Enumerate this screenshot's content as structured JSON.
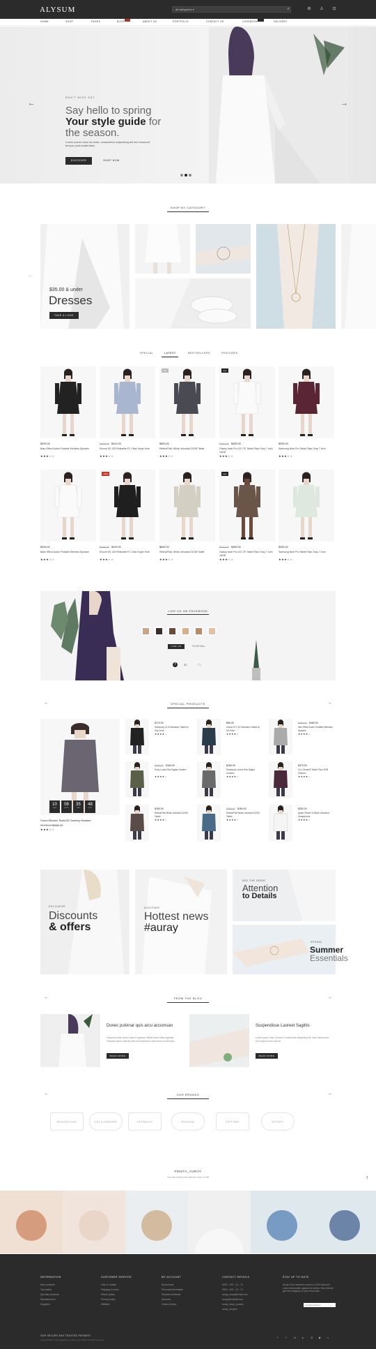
{
  "header": {
    "logo": "ALYSUM",
    "search_placeholder": "all categories",
    "icons": [
      "search-icon",
      "settings-icon",
      "user-icon",
      "cart-icon"
    ]
  },
  "nav": {
    "items": [
      "HOME",
      "SHOP",
      "PAGES",
      "BLOG",
      "ABOUT US",
      "PORTFOLIO",
      "CONTACT US",
      "LOOKBOOK",
      "DELIVERY"
    ],
    "blog_badge": "hot",
    "lookbook_badge": "new"
  },
  "hero": {
    "kicker": "DON'T MISS OUT",
    "line1": "Say hello to spring",
    "line2": "Your style guide",
    "line2_suffix": "for",
    "line3": "the season.",
    "text": "Lorem ipsum dolor sit amet, consectetur adipisicing elit sed eiusmod tempor post-inotat lakto.",
    "btn_discover": "DISCOVER",
    "btn_shop": "SHOP NOW",
    "dots": 3,
    "active_dot": 1
  },
  "categories": {
    "title": "SHOP BY CATEGORY",
    "price": "$35.00 & under",
    "name": "Dresses",
    "btn": "TAKE A LOOK"
  },
  "tabs": {
    "items": [
      "SPECIAL",
      "LATEST",
      "BESTSELLERS",
      "FEATURES"
    ],
    "active": 1
  },
  "products": [
    {
      "name": "Baez Effect Audio Portable Wireless Speaker",
      "old": "",
      "price": "$299.00",
      "rating": 3,
      "label": ""
    },
    {
      "name": "Encore 5S 128 Retinalite FC Clear Super Kine",
      "old": "$499.00",
      "price": "$319.00",
      "rating": 3,
      "label": ""
    },
    {
      "name": "Retina/FlatL White Unlocked 32GB Tablet",
      "old": "",
      "price": "$659.00",
      "rating": 3,
      "label": "sale"
    },
    {
      "name": "Galaxy Note Pro 4G LTE Tablet Titan Gray 7-Inch 16GB",
      "old": "$430.00",
      "price": "$289.00",
      "rating": 3,
      "label": "new"
    },
    {
      "name": "Samsung Note Pro Tablet Titan Gray 7-Inch",
      "old": "",
      "price": "$330.00",
      "rating": 3,
      "label": ""
    },
    {
      "name": "Baez Effect Audio Portable Wireless Speaker",
      "old": "",
      "price": "$299.00",
      "rating": 3,
      "label": ""
    },
    {
      "name": "Encore 5S 128 Retinalite FC Clear Super Kine",
      "old": "$499.00",
      "price": "$319.00",
      "rating": 3,
      "label": "-15%"
    },
    {
      "name": "Retina/FlatL White Unlocked 32GB Tablet",
      "old": "",
      "price": "$659.00",
      "rating": 3,
      "label": ""
    },
    {
      "name": "Galaxy Note Pro 4G LTE Tablet Titan Gray 7-Inch 16GB",
      "old": "$430.00",
      "price": "$289.00",
      "rating": 3,
      "label": "new"
    },
    {
      "name": "Samsung Note Pro Tablet Titan Gray 7-Inch",
      "old": "",
      "price": "$330.00",
      "rating": 3,
      "label": ""
    }
  ],
  "facebook": {
    "title": "LIKE US ON FACEBOOK",
    "like_btn": "LIKE US",
    "likes": "95,000 likes",
    "count": "37"
  },
  "special": {
    "title": "SPECIAL PRODUCTS",
    "countdown": [
      {
        "v": "10",
        "l": "days"
      },
      {
        "v": "08",
        "l": "hours"
      },
      {
        "v": "35",
        "l": "mins"
      },
      {
        "v": "48",
        "l": "secs"
      }
    ],
    "feature_name": "Sound Blaster Tactic3D Gaming Headset",
    "feature_old": "$1,250.00",
    "feature_price": "$380.00",
    "items": [
      {
        "name": "Samsung 12.5 Extension Tablet w/ Key Drive",
        "old": "",
        "price": "$179.00"
      },
      {
        "name": "Canon IXY 32 Extension Tablet w/ Kit Drive",
        "old": "",
        "price": "$96.00"
      },
      {
        "name": "Ibex Effect Audio Portable Wireless Speaker",
        "old": "$480.00",
        "price": "$480.00"
      },
      {
        "name": "Sony Lumix Red Digital Camera",
        "old": "$240.00",
        "price": "$180.00"
      },
      {
        "name": "Panasonic Lumix Red Digital Camera",
        "old": "",
        "price": "$180.00"
      },
      {
        "name": "Cox Ghost42 Tablet Titan 3GB Fashion",
        "old": "",
        "price": "$379.00"
      },
      {
        "name": "Retina/Flat White Unlocked 32GB Tablet",
        "old": "",
        "price": "$180.00"
      },
      {
        "name": "Retina/Flat White Unlocked 32GB Tablet",
        "old": "$380.00",
        "price": "$280.00"
      },
      {
        "name": "Apple iPhone 6 Silver Unlocked Smartphone",
        "old": "",
        "price": "$250.00"
      }
    ]
  },
  "promos": {
    "p1_small": "EXCLUSIVE",
    "p1_a": "Discounts",
    "p1_b": "& offers",
    "p2_small": "DISCOVER",
    "p2_a": "Hottest news",
    "p2_b": "#auray",
    "p3_small": "SEE THE GREAT",
    "p3_a": "Attention",
    "p3_b": "to Details",
    "p4_small": "SPRING",
    "p4_a": "Summer",
    "p4_b": "Essentials"
  },
  "blog": {
    "title": "FROM THE BLOG",
    "posts": [
      {
        "title": "Donec pulvinar quis arcu accumsan",
        "text": "Vivamus mollis auctor ante et egestas. Mattis lorem tellus egestas. Praesent ipsum ultrices nibh id consectetur nulla lorem ut interdum.",
        "btn": "READ MORE"
      },
      {
        "title": "Suspendisse Laoreet Sagittis",
        "text": "Lorem ipsum dolor sit amet, consectetur adipiscing elit. Nam elementum. Ut id turpis lorem erat sit.",
        "btn": "READ MORE"
      }
    ]
  },
  "brands": {
    "title": "OUR BRANDS",
    "items": [
      "MOUNTAIN",
      "YELLOWORK",
      "FITNESS",
      "ROUND",
      "OPTIMA",
      "SPORT"
    ]
  },
  "insta": {
    "title": "#INSTA_AURAY",
    "sub": "You can share your fashion love on #fit"
  },
  "footer": {
    "cols": [
      {
        "title": "INFORMATION",
        "links": [
          "New products",
          "Top sellers",
          "Specials products",
          "Manufacturers",
          "Suppliers"
        ]
      },
      {
        "title": "CUSTOMER SERVICE",
        "links": [
          "Help & contact",
          "Shipping & taxes",
          "Return policy",
          "Privacy policy",
          "Affiliates"
        ]
      },
      {
        "title": "MY ACCOUNT",
        "links": [
          "My account",
          "Personal information",
          "Payment methods",
          "Discount",
          "Orders history"
        ]
      },
      {
        "title": "CONTACT DETAILS",
        "links": [
          "0000 - 000 - 12 - 74",
          "0000 - 000 - 12 - 74",
          "auray_shop@email.com",
          "auray@hotmail.com",
          "auray_shop_contact",
          "auray_shopmr"
        ]
      },
      {
        "title": "STAY UP TO DATE",
        "links": [
          "Auray Club members receive a 15% discount code redeemable against all orders. Now friends get free shipping on your first order."
        ]
      }
    ],
    "newsletter_placeholder": "your@email.com",
    "bottom_title": "OUR SECURE AND TRUSTED PAYMENT",
    "bottom_text": "Auray fashion. Free shipping on orders over $100. All rights reserved.",
    "social": [
      "facebook-icon",
      "twitter-icon",
      "linkedin-icon",
      "pinterest-icon",
      "instagram-icon",
      "youtube-icon",
      "vimeo-icon"
    ]
  }
}
